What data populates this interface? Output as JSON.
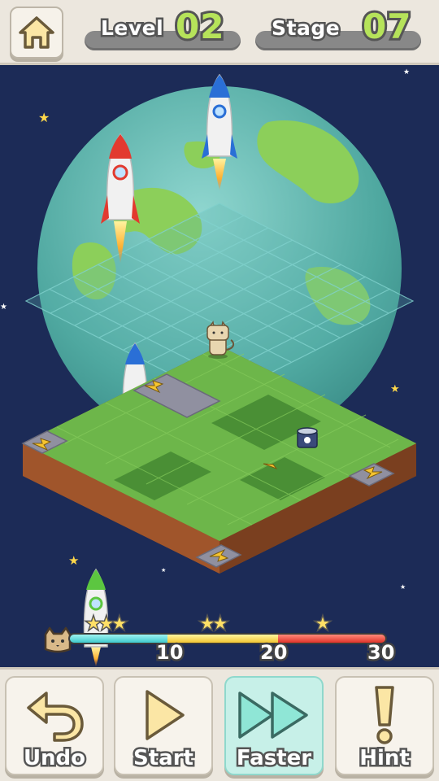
{
  "header": {
    "level_label": "Level",
    "level_value": "02",
    "stage_label": "Stage",
    "stage_value": "07"
  },
  "progress": {
    "ticks": [
      "10",
      "20",
      "30"
    ],
    "star_groups": [
      "★★★",
      "★★",
      "★"
    ]
  },
  "controls": {
    "undo_label": "Undo",
    "start_label": "Start",
    "faster_label": "Faster",
    "hint_label": "Hint",
    "hint_glyph": "!"
  },
  "colors": {
    "grass": "#6db64a",
    "dirt": "#a0552b",
    "space": "#1c2b57",
    "planet": "#4fa8a0",
    "accent_green": "#b6e35a"
  }
}
